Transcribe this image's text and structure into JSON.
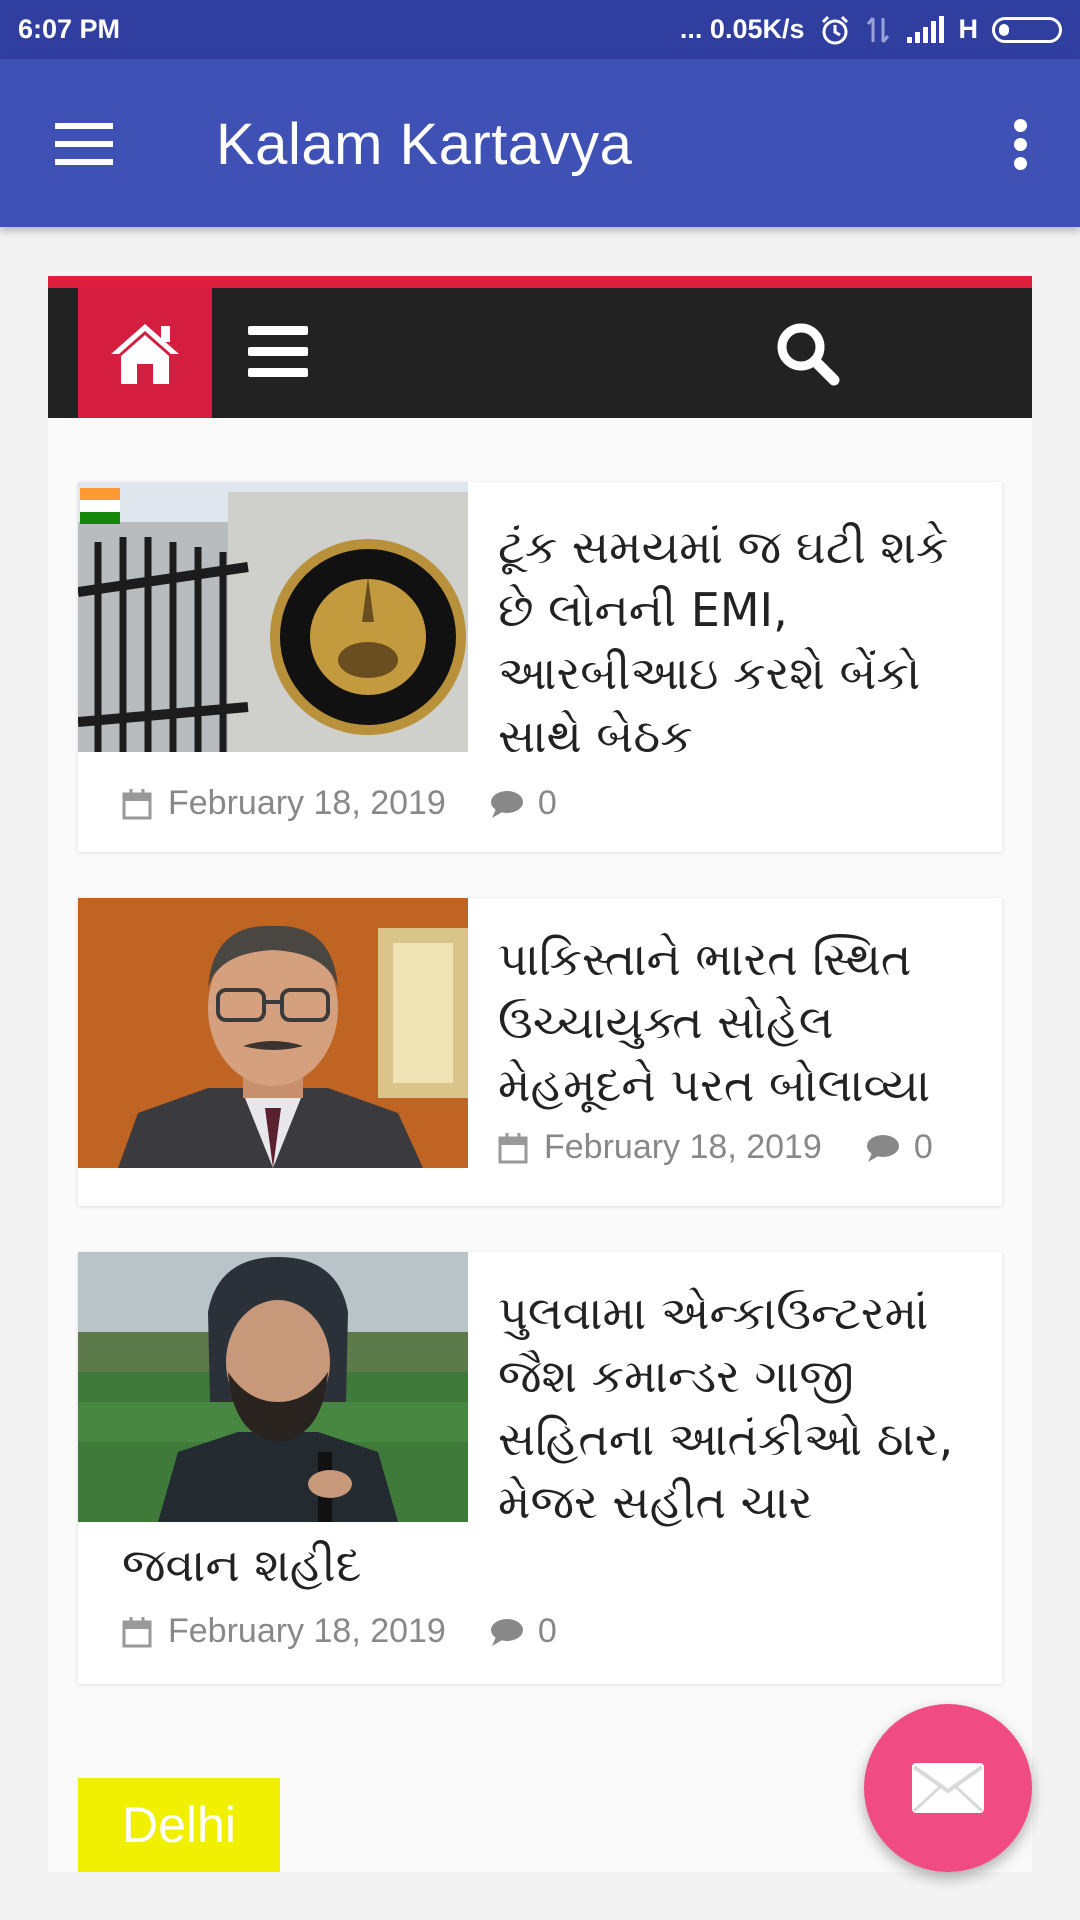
{
  "status_bar": {
    "time": "6:07 PM",
    "network_speed": "... 0.05K/s",
    "network_type": "H"
  },
  "app_bar": {
    "title": "Kalam Kartavya"
  },
  "site_nav": {
    "accent_color": "#d41d3f"
  },
  "articles": [
    {
      "headline": "ટૂંક સમયમાં જ ઘટી શકે છે લોનની EMI, આરબીઆઇ કરશે બેંકો સાથે બેઠક",
      "date": "February 18, 2019",
      "comments": "0",
      "image": "rbi-seal-gate-photo"
    },
    {
      "headline": "પાકિસ્તાને ભારત સ્થિત ઉચ્ચાયુક્ત સોહેલ મેહમૂદને પરત બોલાવ્યા",
      "date": "February 18, 2019",
      "comments": "0",
      "image": "man-with-glasses-photo"
    },
    {
      "headline_part1": "પુલવામા એન્કાઉન્ટરમાં જૈશ કમાન્ડર ગાજી સહિતના આતંકીઓ ઠાર, મેજર સહીત ચાર",
      "headline_part2": "જવાન શહીદ",
      "date": "February 18, 2019",
      "comments": "0",
      "image": "bearded-man-outdoor-photo"
    }
  ],
  "category": {
    "label": "Delhi",
    "color": "#f0f000"
  },
  "fab": {
    "icon": "envelope-icon",
    "color": "#f14b84"
  }
}
